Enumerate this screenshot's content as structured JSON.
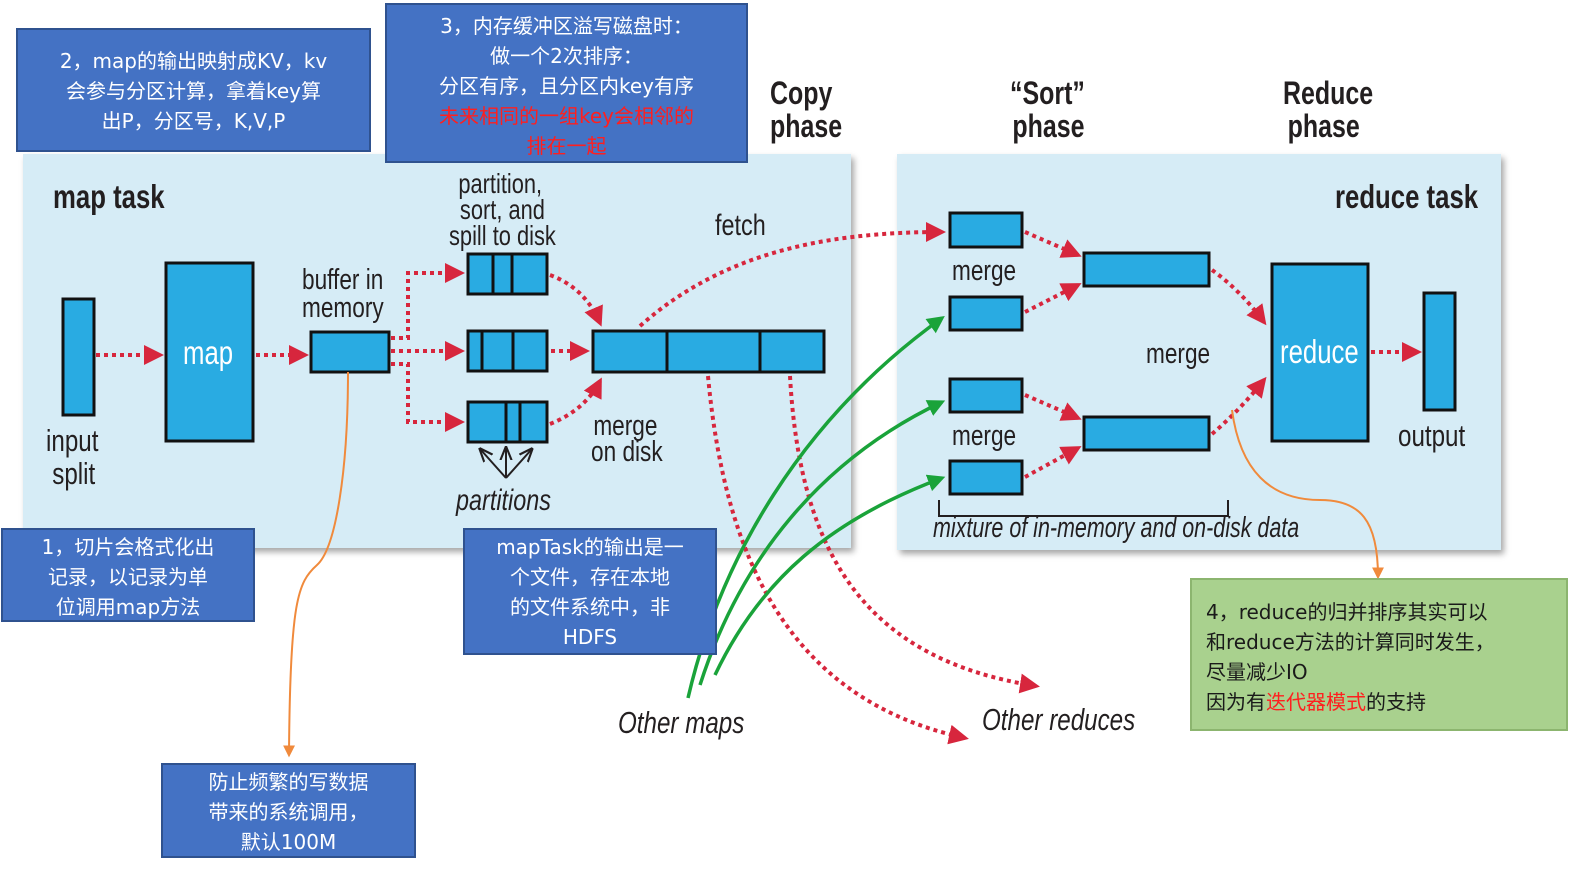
{
  "phases": {
    "copy": [
      "Copy",
      "phase"
    ],
    "sort": [
      "“Sort”",
      "phase"
    ],
    "reduce": [
      "Reduce",
      "phase"
    ]
  },
  "map_task": {
    "title": "map task",
    "input_split": [
      "input",
      "split"
    ],
    "map": "map",
    "buffer": [
      "buffer in",
      "memory"
    ],
    "partition": [
      "partition,",
      "sort, and",
      "spill to disk"
    ],
    "partitions": "partitions",
    "merge_on_disk": [
      "merge",
      "on disk"
    ],
    "fetch": "fetch"
  },
  "reduce_task": {
    "title": "reduce task",
    "merge_top": "merge",
    "merge_bottom": "merge",
    "merge_center": "merge",
    "reduce": "reduce",
    "output": "output",
    "mixture": "mixture of in-memory and on-disk data"
  },
  "other_maps": "Other maps",
  "other_reduces": "Other reduces",
  "notes": {
    "n1": [
      "1，切片会格式化出",
      "记录，以记录为单",
      "位调用map方法"
    ],
    "n2": [
      "2，map的输出映射成KV，kv",
      "会参与分区计算，拿着key算",
      "出P，分区号，K,V,P"
    ],
    "n3": {
      "lines": [
        "3，内存缓冲区溢写磁盘时：",
        "做一个2次排序：",
        "分区有序，且分区内key有序"
      ],
      "red_lines": [
        "未来相同的一组key会相邻的",
        "排在一起"
      ]
    },
    "n4": {
      "lines": [
        "4，reduce的归并排序其实可以",
        "和reduce方法的计算同时发生，",
        "尽量减少IO"
      ],
      "last_prefix": "因为有",
      "last_red": "迭代器模式",
      "last_suffix": "的支持"
    },
    "n5": [
      "mapTask的输出是一",
      "个文件，存在本地",
      "的文件系统中，非",
      "HDFS"
    ],
    "n6": [
      "防止频繁的写数据",
      "带来的系统调用，",
      "默认100M"
    ]
  },
  "colors": {
    "panel": "#d6ecf6",
    "box_fill": "#29abe2",
    "note_blue": "#4472c4",
    "note_green": "#a9d18e",
    "arrow_red": "#d7263d",
    "arrow_green": "#1aa33a",
    "arrow_orange": "#f08a3c"
  }
}
